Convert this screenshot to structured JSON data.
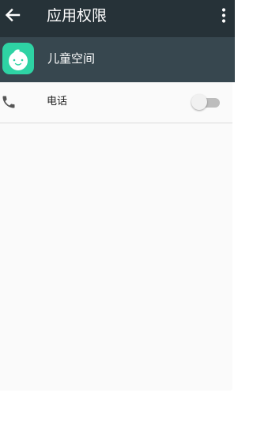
{
  "toolbar": {
    "title": "应用权限",
    "back_icon": "arrow-back-icon",
    "menu_icon": "more-vert-icon",
    "background": "#263238"
  },
  "app": {
    "name": "儿童空间",
    "icon": "baby-face-icon",
    "icon_color": "#2ed3a4",
    "header_background": "#37474f"
  },
  "permissions": [
    {
      "label": "电话",
      "icon": "phone-icon",
      "enabled": false
    }
  ]
}
